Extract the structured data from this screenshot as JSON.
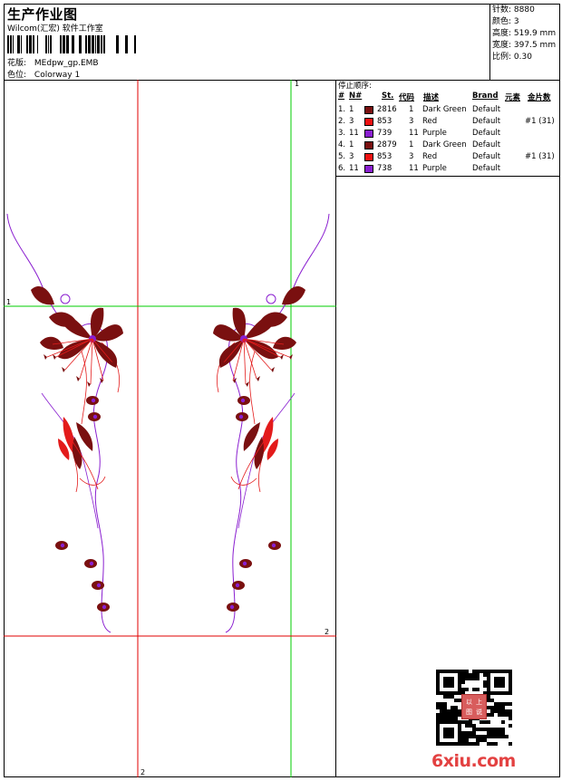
{
  "header": {
    "title": "生产作业图",
    "subtitle": "Wilcom(汇宏) 软件工作室",
    "design_label": "花版:",
    "design_value": "MEdpw_gp.EMB",
    "colorway_label": "色位:",
    "colorway_value": "Colorway 1"
  },
  "specs": [
    {
      "label": "针数:",
      "value": "8880"
    },
    {
      "label": "颜色:",
      "value": "3"
    },
    {
      "label": "高度:",
      "value": "519.9 mm"
    },
    {
      "label": "宽度:",
      "value": "397.5 mm"
    },
    {
      "label": "比例:",
      "value": "0.30"
    }
  ],
  "stop_sequence": {
    "title": "停止顺序:",
    "headers": {
      "num": "#",
      "needle": "N#",
      "st": "St.",
      "code": "代码",
      "desc": "描述",
      "brand": "Brand",
      "element": "元素",
      "sequin": "金片数"
    },
    "rows": [
      {
        "num": "1.",
        "needle": "1",
        "swatch": "#7a1010",
        "st": "2816",
        "code": "1",
        "desc": "Dark Green",
        "brand": "Default",
        "sequin": ""
      },
      {
        "num": "2.",
        "needle": "3",
        "swatch": "#ee1111",
        "st": "853",
        "code": "3",
        "desc": "Red",
        "brand": "Default",
        "sequin": "#1 (31)"
      },
      {
        "num": "3.",
        "needle": "11",
        "swatch": "#8a1fd0",
        "st": "739",
        "code": "11",
        "desc": "Purple",
        "brand": "Default",
        "sequin": ""
      },
      {
        "num": "4.",
        "needle": "1",
        "swatch": "#7a1010",
        "st": "2879",
        "code": "1",
        "desc": "Dark Green",
        "brand": "Default",
        "sequin": ""
      },
      {
        "num": "5.",
        "needle": "3",
        "swatch": "#ee1111",
        "st": "853",
        "code": "3",
        "desc": "Red",
        "brand": "Default",
        "sequin": "#1 (31)"
      },
      {
        "num": "6.",
        "needle": "11",
        "swatch": "#8a1fd0",
        "st": "738",
        "code": "11",
        "desc": "Purple",
        "brand": "Default",
        "sequin": ""
      }
    ]
  },
  "guides": {
    "vertical_1": "1",
    "horizontal_1": "1",
    "horizontal_2": "2",
    "vertical_2": "2"
  },
  "colors": {
    "dark_red": "#7a1010",
    "red": "#e31b1b",
    "purple": "#8a1fd0",
    "guide_red": "#e00000",
    "guide_green": "#00cc00"
  },
  "watermark": {
    "site": "6xiu.com",
    "stamp_chars": [
      "以",
      "上",
      "图",
      "说"
    ]
  }
}
